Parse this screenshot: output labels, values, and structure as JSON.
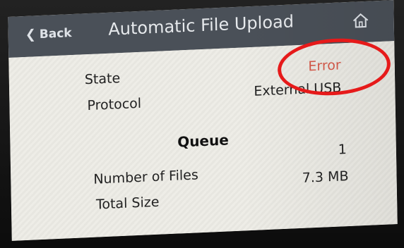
{
  "header": {
    "back_label": "Back",
    "title": "Automatic File Upload"
  },
  "status": {
    "state_label": "State",
    "state_value": "Error",
    "protocol_label": "Protocol",
    "protocol_value": "External USB"
  },
  "queue": {
    "title": "Queue",
    "files_label": "Number of Files",
    "files_value": "1",
    "size_label": "Total Size",
    "size_value": "7.3 MB"
  },
  "colors": {
    "header_bg": "#4a5058",
    "error": "#d65a4a",
    "annotation_circle": "#e61a1a"
  },
  "icons": {
    "back": "chevron-left-icon",
    "home": "home-icon"
  }
}
